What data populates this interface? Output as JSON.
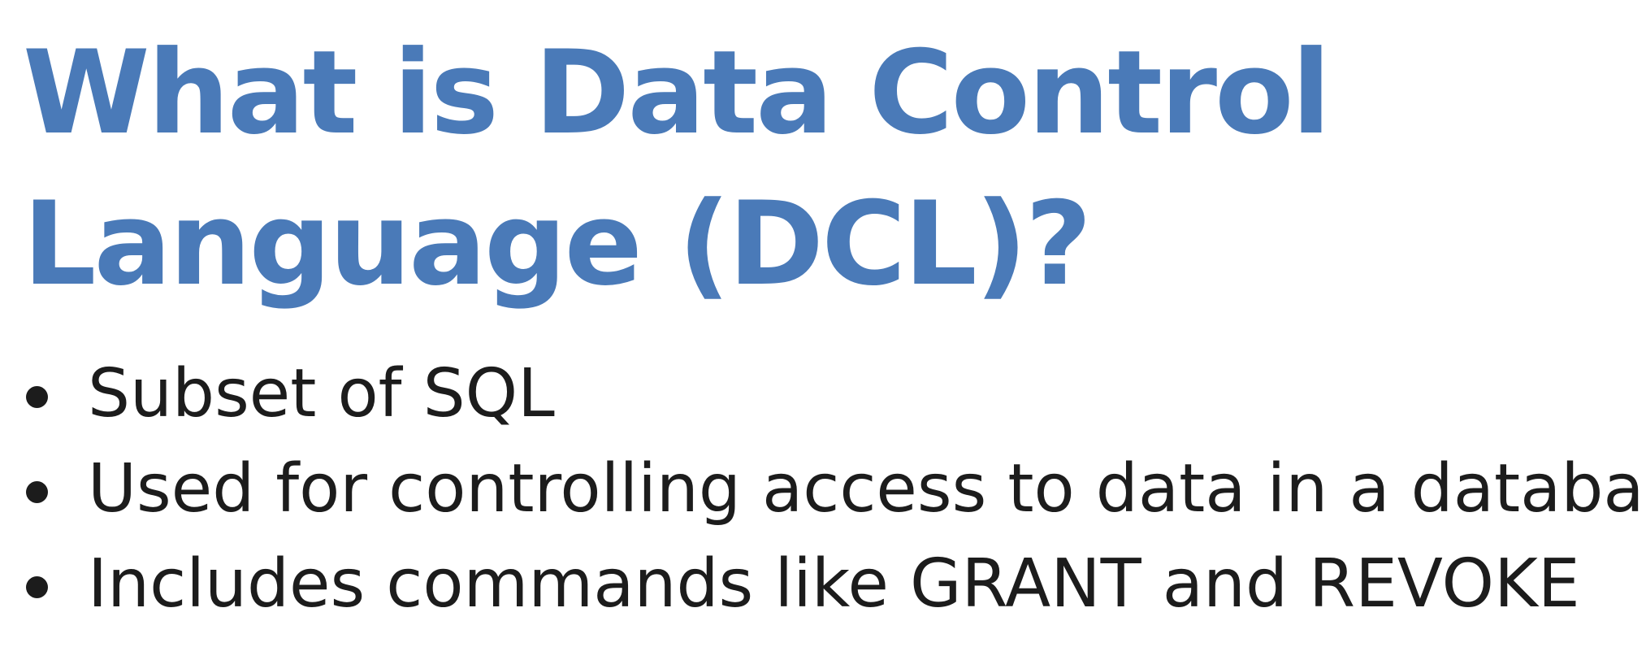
{
  "slide": {
    "title_line_1": "What is Data Control",
    "title_line_2": "Language (DCL)?",
    "bullets": [
      "Subset of SQL",
      "Used for controlling access to data in a database",
      "Includes commands like GRANT and REVOKE"
    ],
    "colors": {
      "title": "#4a7ab8",
      "body_text": "#1c1c1c",
      "background": "#ffffff"
    }
  }
}
